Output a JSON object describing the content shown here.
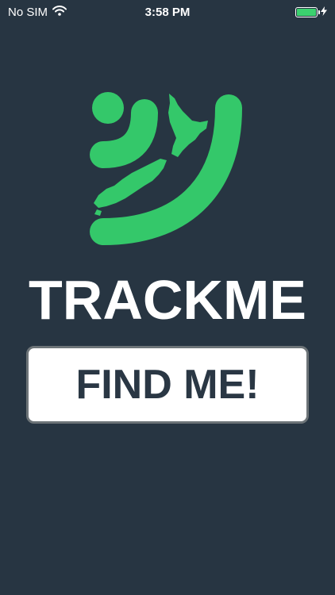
{
  "status_bar": {
    "carrier": "No SIM",
    "time": "3:58 PM",
    "icons": [
      "wifi-icon",
      "battery-icon",
      "charging-bolt-icon"
    ]
  },
  "logo": {
    "icon": "trackme-logo-icon",
    "accent_color": "#34c86a"
  },
  "brand": {
    "name": "TRACKME"
  },
  "action": {
    "find_label": "FIND ME!"
  },
  "colors": {
    "background": "#273542",
    "accent": "#34c86a",
    "button_text": "#2a3744",
    "button_border": "#6d7478"
  }
}
